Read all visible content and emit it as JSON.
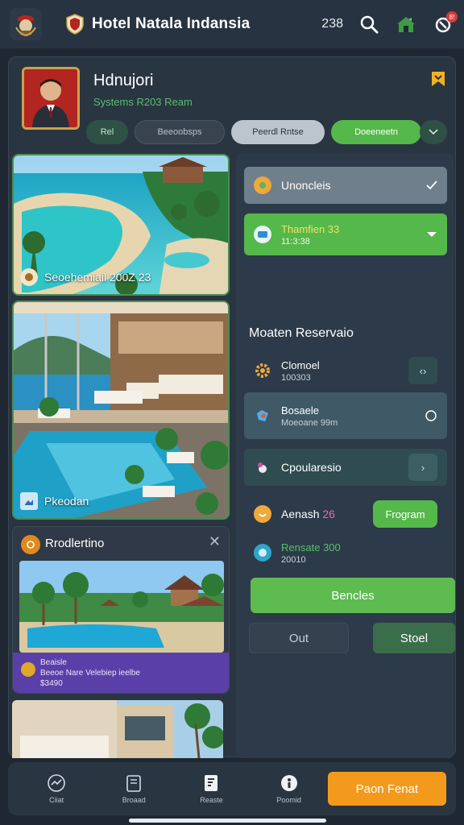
{
  "header": {
    "title": "Hotel Natala Indansia",
    "count": "238",
    "notification_badge": "8!",
    "icons": [
      "emblem-icon",
      "shield-icon",
      "search-icon",
      "hotel-icon",
      "notification-icon"
    ]
  },
  "profile": {
    "name": "Hdnujori",
    "subtitle": "Systems R203 Ream",
    "pills": [
      "Rel",
      "Beeoobsps",
      "Peerdl Rntse",
      "Doeeneetn"
    ],
    "accent_color": "#55b84a"
  },
  "gallery": {
    "photo1_caption": "Seoehemiail 200Z 23",
    "photo2_caption": "Pkeodan"
  },
  "promo": {
    "title": "Rrodlertino",
    "info_line1": "Beaisle",
    "info_line2": "Beeoe Nare Velebiep ieelbe",
    "info_line3": "$3490"
  },
  "right_panel": {
    "row1_label": "Unoncleis",
    "row2_line1": "Thamfien 33",
    "row2_line2": "11:3:38",
    "section_title": "Moaten Reservaio",
    "row3_line1": "Clomoel",
    "row3_line2": "100303",
    "row4_line1": "Bosaele",
    "row4_line2": "Moeoane 99m",
    "row5_label": "Cpoularesio",
    "row6_prefix": "Aenash",
    "row6_value": "26",
    "row6_button": "Frogram",
    "row7_line1": "Rensate 300",
    "row7_line2": "20010",
    "primary_button": "Bencles",
    "out_button": "Out",
    "start_button": "Stoel"
  },
  "bottom_nav": {
    "items": [
      "Ciiat",
      "Broaad",
      "Reaste",
      "Poomid"
    ],
    "cta": "Paon Fenat"
  }
}
